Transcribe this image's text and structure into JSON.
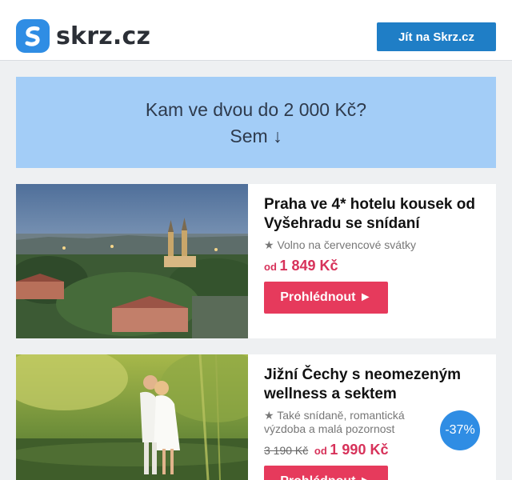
{
  "header": {
    "logo_text": "skrz.cz",
    "cta_label": "Jít na Skrz.cz"
  },
  "banner": {
    "line1": "Kam ve dvou do 2 000 Kč?",
    "line2": "Sem ↓"
  },
  "cards": [
    {
      "title": "Praha ve 4* hotelu kousek od Vyšehradu se snídaní",
      "subtitle": "★ Volno na červencové svátky",
      "price_prefix": "od",
      "price": "1 849 Kč",
      "button_label": "Prohlédnout ►"
    },
    {
      "title": "Jižní Čechy s neomezeným wellness a sektem",
      "subtitle": "★ Také snídaně, romantická výzdoba a malá pozornost",
      "old_price": "3 190 Kč",
      "price_prefix": "od",
      "price": "1 990 Kč",
      "discount": "-37%",
      "button_label": "Prohlédnout ►"
    }
  ],
  "colors": {
    "brand_blue": "#2f8de4",
    "cta_blue": "#1f7ec6",
    "banner_bg": "#a3cdf7",
    "button_red": "#e63a5c",
    "price_red": "#d7325a"
  }
}
